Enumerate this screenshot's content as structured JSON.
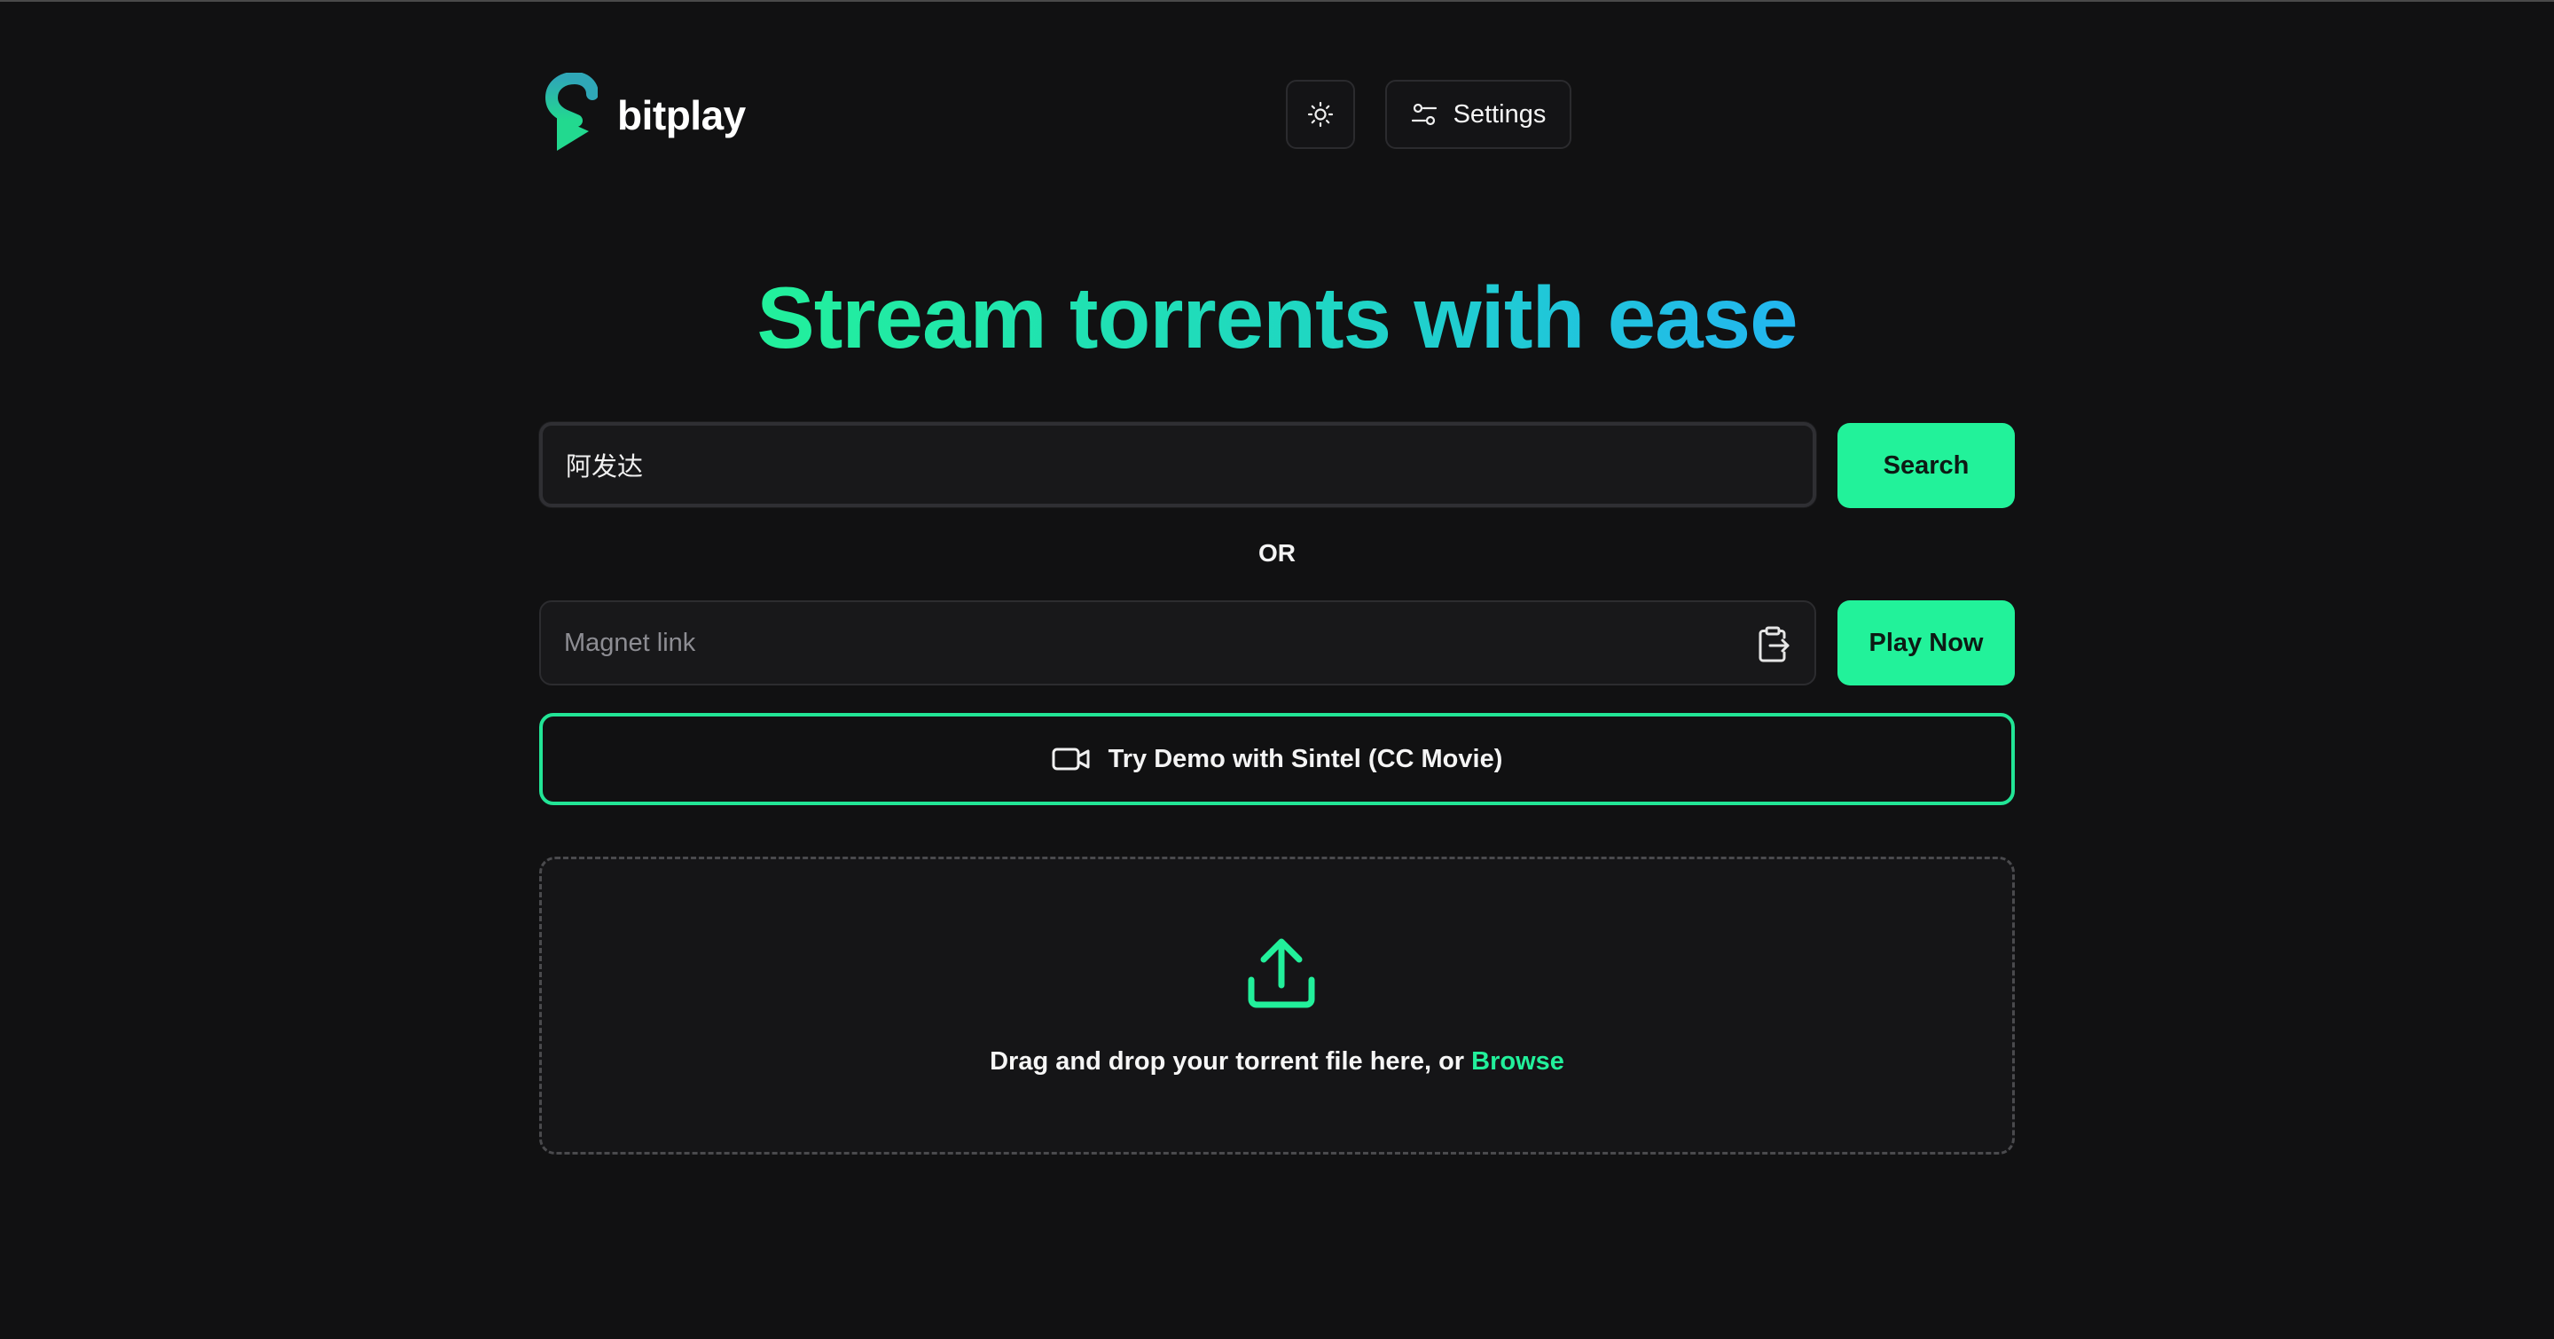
{
  "app": {
    "name": "bitplay"
  },
  "header": {
    "settings_label": "Settings"
  },
  "hero": {
    "title": "Stream torrents with ease"
  },
  "search": {
    "value": "阿发达",
    "button_label": "Search"
  },
  "divider": {
    "or_label": "OR"
  },
  "magnet": {
    "placeholder": "Magnet link",
    "button_label": "Play Now"
  },
  "demo": {
    "label": "Try Demo with Sintel (CC Movie)"
  },
  "dropzone": {
    "text": "Drag and drop your torrent file here, or ",
    "browse_label": "Browse"
  },
  "colors": {
    "accent": "#22f29a",
    "background": "#111112",
    "gradient_end": "#22b6f0"
  },
  "icons": {
    "logo": "bitplay-logo-icon",
    "theme": "sun-icon",
    "settings": "sliders-icon",
    "paste": "clipboard-paste-icon",
    "demo": "video-camera-icon",
    "upload": "upload-icon"
  }
}
